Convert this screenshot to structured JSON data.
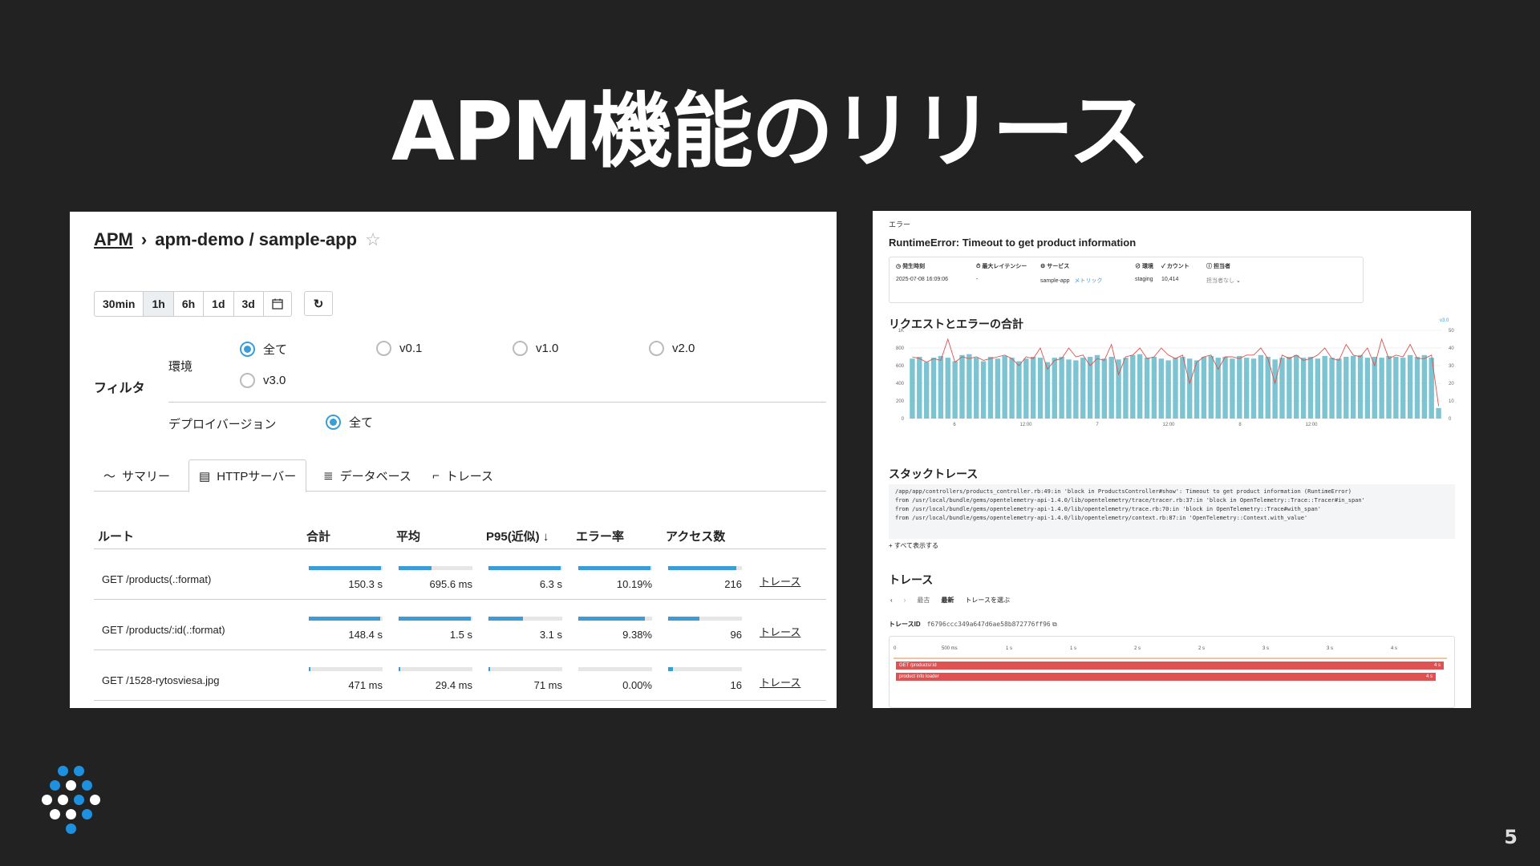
{
  "slide": {
    "title": "APM機能のリリース",
    "page_number": "5"
  },
  "left_panel": {
    "breadcrumb": {
      "root": "APM",
      "separator": "›",
      "path": "apm-demo / sample-app"
    },
    "time_ranges": [
      "30min",
      "1h",
      "6h",
      "1d",
      "3d"
    ],
    "selected_time_range": "1h",
    "filter": {
      "label": "フィルタ",
      "environment_label": "環境",
      "environment_options": [
        "全て",
        "v0.1",
        "v1.0",
        "v2.0",
        "v3.0"
      ],
      "environment_selected": "全て",
      "deploy_label": "デプロイバージョン",
      "deploy_options": [
        "全て"
      ],
      "deploy_selected": "全て"
    },
    "tabs": [
      "サマリー",
      "HTTPサーバー",
      "データベース",
      "トレース"
    ],
    "active_tab": "HTTPサーバー",
    "table": {
      "columns": [
        "ルート",
        "合計",
        "平均",
        "P95(近似) ↓",
        "エラー率",
        "アクセス数"
      ],
      "rows": [
        {
          "route": "GET /products(.:format)",
          "total": "150.3 s",
          "avg": "695.6 ms",
          "p95": "6.3 s",
          "error_rate": "10.19%",
          "access": "216",
          "link": "トレース",
          "bars": [
            0.98,
            0.45,
            0.98,
            0.98,
            0.92
          ]
        },
        {
          "route": "GET /products/:id(.:format)",
          "total": "148.4 s",
          "avg": "1.5 s",
          "p95": "3.1 s",
          "error_rate": "9.38%",
          "access": "96",
          "link": "トレース",
          "bars": [
            0.97,
            0.98,
            0.47,
            0.9,
            0.42
          ]
        },
        {
          "route": "GET /1528-rytosviesa.jpg",
          "total": "471 ms",
          "avg": "29.4 ms",
          "p95": "71 ms",
          "error_rate": "0.00%",
          "access": "16",
          "link": "トレース",
          "bars": [
            0.02,
            0.02,
            0.02,
            0.0,
            0.07
          ]
        }
      ]
    }
  },
  "right_panel": {
    "label": "エラー",
    "title": "RuntimeError: Timeout to get product information",
    "info": {
      "occurred_label": "発生時刻",
      "occurred_value": "2025-07-08 16:09:06",
      "latency_label": "最大レイテンシー",
      "latency_value": "-",
      "service_label": "サービス",
      "service_value": "sample-app",
      "service_link": "メトリック",
      "env_label": "環境",
      "env_value": "staging",
      "count_label": "カウント",
      "count_value": "10,414",
      "owner_label": "担当者",
      "owner_value": "担当者なし"
    },
    "chart_title": "リクエストとエラーの合計",
    "chart_legend": "v3.0",
    "stack_title": "スタックトレース",
    "stack_lines": [
      "/app/app/controllers/products_controller.rb:49:in 'block in ProductsController#show': Timeout to get product information (RuntimeError)",
      "        from /usr/local/bundle/gems/opentelemetry-api-1.4.0/lib/opentelemetry/trace/tracer.rb:37:in 'block in OpenTelemetry::Trace::Tracer#in_span'",
      "        from /usr/local/bundle/gems/opentelemetry-api-1.4.0/lib/opentelemetry/trace.rb:70:in 'block in OpenTelemetry::Trace#with_span'",
      "        from /usr/local/bundle/gems/opentelemetry-api-1.4.0/lib/opentelemetry/context.rb:87:in 'OpenTelemetry::Context.with_value'"
    ],
    "show_all": "すべて表示する",
    "trace_title": "トレース",
    "trace_nav": {
      "prev": "‹",
      "next": "›",
      "oldest": "最古",
      "latest": "最新",
      "select": "トレースを選ぶ"
    },
    "trace_id_label": "トレースID",
    "trace_id": "f6796ccc349a647d6ae58b872776ff96",
    "trace_ticks": [
      "0",
      "500 ms",
      "1 s",
      "1 s",
      "2 s",
      "2 s",
      "3 s",
      "3 s",
      "4 s"
    ],
    "spans": [
      {
        "name": "GET /products/:id",
        "duration": "4 s"
      },
      {
        "name": "product info loader",
        "duration": "4 s"
      }
    ]
  },
  "chart_data": {
    "type": "bar",
    "title": "リクエストとエラーの合計",
    "legend": [
      "v3.0"
    ],
    "y_left_ticks": [
      "0",
      "200",
      "400",
      "600",
      "800",
      "1K"
    ],
    "y_right_ticks": [
      "0",
      "10",
      "20",
      "30",
      "40",
      "50"
    ],
    "x_tick_labels": [
      "6",
      "12:00",
      "7",
      "12:00",
      "8",
      "12:00"
    ],
    "ylim_left": [
      0,
      1000
    ],
    "ylim_right": [
      0,
      50
    ],
    "series": [
      {
        "name": "requests",
        "values": [
          680,
          700,
          640,
          690,
          710,
          690,
          650,
          720,
          730,
          690,
          650,
          700,
          680,
          710,
          690,
          650,
          680,
          700,
          690,
          640,
          690,
          700,
          670,
          660,
          690,
          700,
          720,
          680,
          700,
          670,
          690,
          720,
          730,
          690,
          700,
          680,
          660,
          690,
          700,
          680,
          660,
          700,
          710,
          690,
          700,
          680,
          710,
          690,
          680,
          720,
          700,
          670,
          690,
          700,
          720,
          690,
          700,
          680,
          710,
          690,
          680,
          700,
          710,
          720,
          690,
          700,
          690,
          710,
          700,
          690,
          720,
          700,
          720,
          690,
          120
        ]
      },
      {
        "name": "errors",
        "values": [
          35,
          34,
          32,
          34,
          33,
          45,
          32,
          35,
          34,
          35,
          33,
          34,
          35,
          36,
          34,
          30,
          35,
          34,
          40,
          28,
          33,
          34,
          40,
          35,
          36,
          30,
          34,
          33,
          42,
          25,
          35,
          36,
          40,
          34,
          35,
          40,
          36,
          34,
          36,
          20,
          32,
          35,
          36,
          28,
          35,
          35,
          34,
          36,
          36,
          40,
          34,
          20,
          36,
          34,
          36,
          33,
          34,
          36,
          40,
          34,
          33,
          42,
          36,
          35,
          40,
          30,
          45,
          34,
          36,
          35,
          42,
          34,
          34,
          36,
          7
        ]
      }
    ]
  }
}
